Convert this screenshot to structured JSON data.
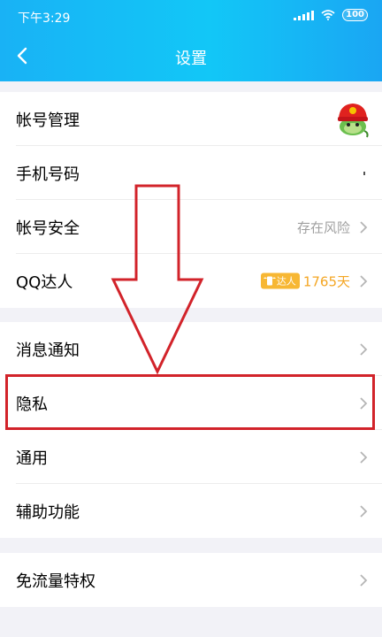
{
  "status_bar": {
    "time": "下午3:29",
    "battery": "100"
  },
  "header": {
    "title": "设置",
    "back_icon": "chevron-left-icon"
  },
  "groups": [
    {
      "rows": [
        {
          "label": "帐号管理",
          "accessory": "avatar-icon"
        },
        {
          "label": "手机号码",
          "accessory": "dot"
        },
        {
          "label": "帐号安全",
          "right_text": "存在风险",
          "accessory": "chevron-right-icon"
        },
        {
          "label": "QQ达人",
          "badge_text": "达人",
          "right_text": "1765天",
          "accessory": "chevron-right-icon"
        }
      ]
    },
    {
      "rows": [
        {
          "label": "消息通知",
          "accessory": "chevron-right-icon"
        },
        {
          "label": "隐私",
          "accessory": "chevron-right-icon"
        },
        {
          "label": "通用",
          "accessory": "chevron-right-icon"
        },
        {
          "label": "辅助功能",
          "accessory": "chevron-right-icon"
        }
      ]
    },
    {
      "rows": [
        {
          "label": "免流量特权",
          "accessory": "chevron-right-icon"
        }
      ]
    }
  ],
  "annotation": {
    "arrow_color": "#d2232a",
    "highlight_target": "隐私"
  },
  "colors": {
    "header_gradient_start": "#19b2f5",
    "header_gradient_end": "#1aa6f3",
    "page_background": "#f2f2f7",
    "warning_text": "#a0a0a0",
    "daren_orange": "#f4a623"
  }
}
